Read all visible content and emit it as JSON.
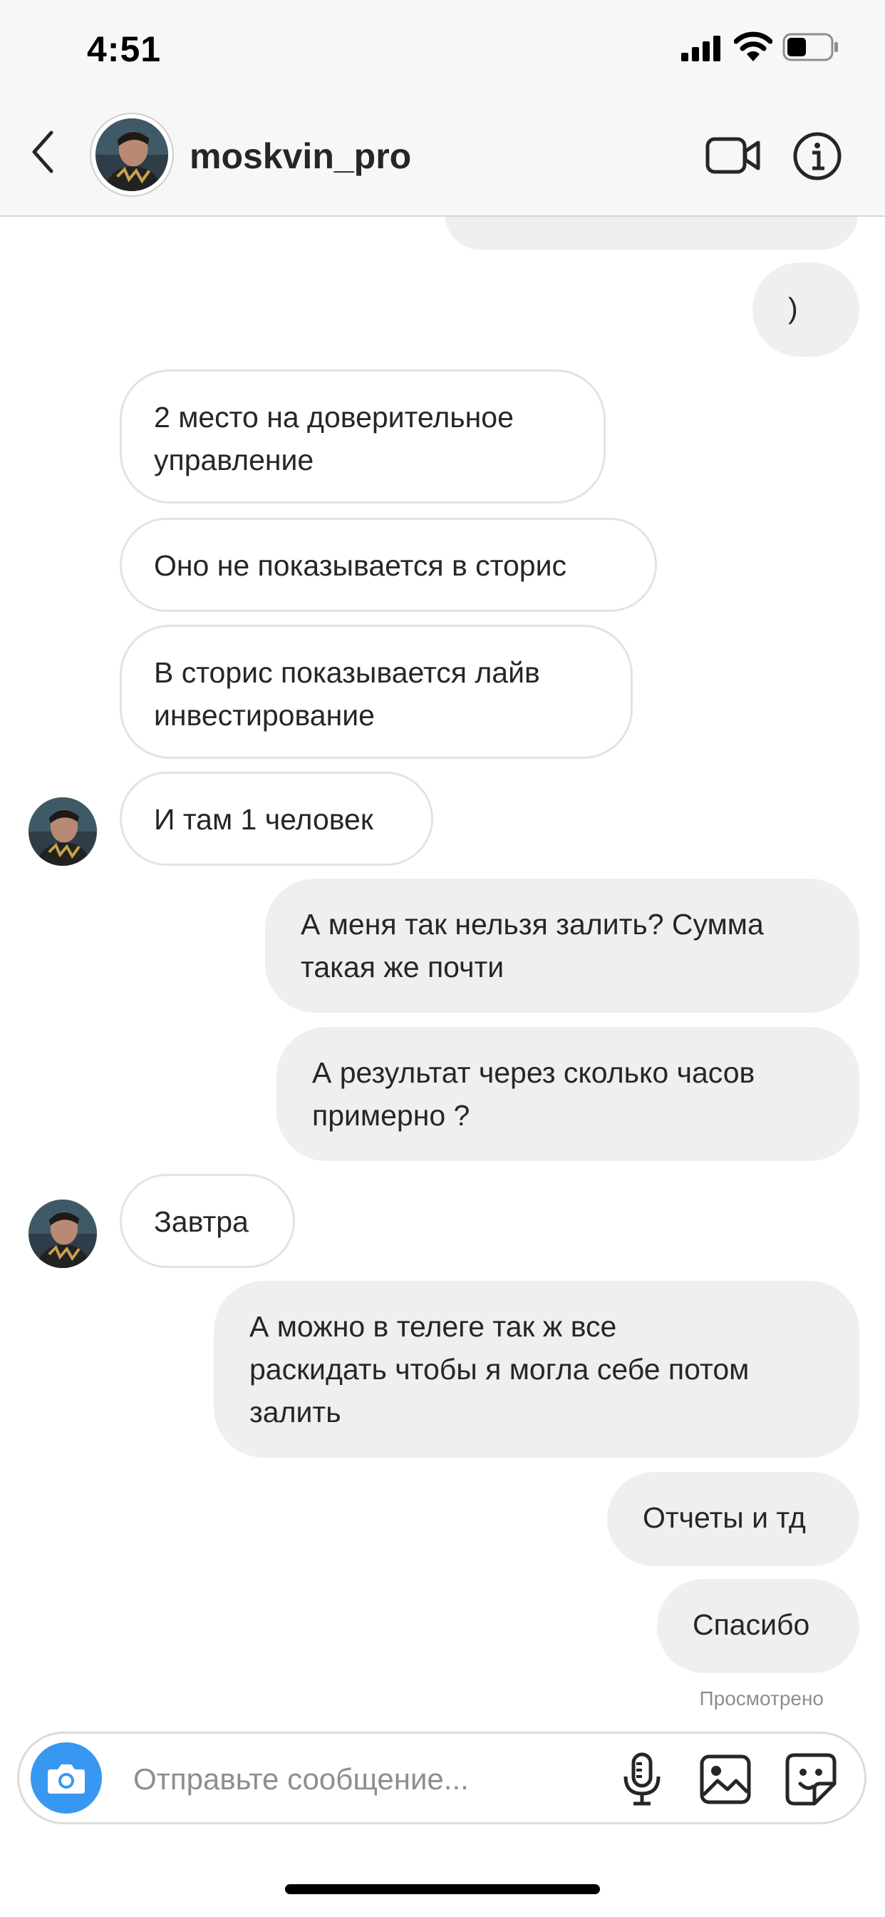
{
  "status_bar": {
    "time": "4:51",
    "battery_level": 0.45
  },
  "header": {
    "username": "moskvin_pro"
  },
  "messages": [
    {
      "from": "me",
      "text": ""
    },
    {
      "from": "me",
      "text": ")"
    },
    {
      "from": "them",
      "text": "2 место на доверительное\nуправление"
    },
    {
      "from": "them",
      "text": "Оно не показывается в сторис"
    },
    {
      "from": "them",
      "text": "В сторис показывается лайв\nинвестирование"
    },
    {
      "from": "them",
      "text": "И там 1 человек"
    },
    {
      "from": "me",
      "text": "А меня так нельзя залить? Сумма\nтакая же почти"
    },
    {
      "from": "me",
      "text": "А результат через сколько часов\nпримерно ?"
    },
    {
      "from": "them",
      "text": "Завтра"
    },
    {
      "from": "me",
      "text": "А можно в телеге так ж все\nраскидать чтобы я могла себе потом\nзалить"
    },
    {
      "from": "me",
      "text": "Отчеты и тд"
    },
    {
      "from": "me",
      "text": "Спасибо"
    }
  ],
  "seen_label": "Просмотрено",
  "composer": {
    "placeholder": "Отправьте сообщение..."
  },
  "colors": {
    "accent": "#3897f0",
    "outgoing_bubble": "#efefef",
    "incoming_border": "#e3e3e3"
  },
  "icons": [
    "back-chevron",
    "video-camera",
    "info",
    "camera",
    "microphone",
    "gallery",
    "sticker"
  ]
}
